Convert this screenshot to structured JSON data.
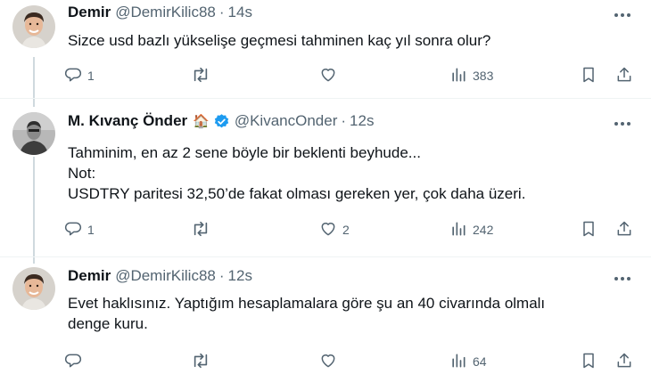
{
  "tweets": [
    {
      "name": "Demir",
      "handle": "@DemirKilic88",
      "time": "14s",
      "text_lines": [
        "Sizce usd bazlı yükselişe geçmesi tahminen kaç yıl sonra olur?"
      ],
      "stats": {
        "replies": "1",
        "retweets": "",
        "likes": "",
        "views": "383"
      }
    },
    {
      "name": "M. Kıvanç Önder",
      "name_emoji": "🏠",
      "verified": true,
      "handle": "@KivancOnder",
      "time": "12s",
      "text_lines": [
        "Tahminim, en az 2 sene böyle bir beklenti beyhude...",
        "Not:",
        "USDTRY paritesi 32,50’de fakat olması gereken yer, çok daha üzeri."
      ],
      "stats": {
        "replies": "1",
        "retweets": "",
        "likes": "2",
        "views": "242"
      }
    },
    {
      "name": "Demir",
      "handle": "@DemirKilic88",
      "time": "12s",
      "text_lines": [
        "Evet haklısınız. Yaptığım hesaplamalara göre şu an 40 civarında olmalı",
        "denge kuru."
      ],
      "stats": {
        "replies": "",
        "retweets": "",
        "likes": "",
        "views": "64"
      }
    }
  ],
  "separator": "·",
  "icons": {
    "reply": "reply-icon",
    "retweet": "retweet-icon",
    "like": "heart-icon",
    "views": "views-icon",
    "bookmark": "bookmark-icon",
    "share": "share-icon",
    "more": "more-icon",
    "verified": "verified-badge-icon"
  },
  "colors": {
    "text": "#0f1419",
    "secondary": "#536471",
    "verified": "#1d9bf0",
    "divider": "#eff3f4",
    "thread_line": "#cfd9de"
  }
}
